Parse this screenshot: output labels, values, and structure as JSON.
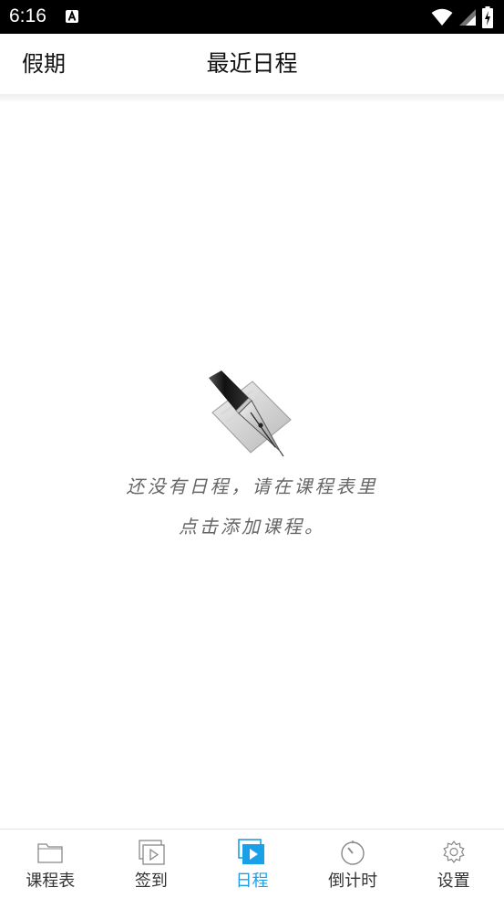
{
  "status_bar": {
    "time": "6:16",
    "icons": [
      "notification-a-icon",
      "wifi-icon",
      "signal-icon",
      "battery-charging-icon"
    ]
  },
  "header": {
    "left_label": "假期",
    "title": "最近日程"
  },
  "empty_state": {
    "icon": "fountain-pen-icon",
    "line1": "还没有日程，请在课程表里",
    "line2": "点击添加课程。"
  },
  "bottom_nav": {
    "active_index": 2,
    "active_color": "#1aa0e8",
    "items": [
      {
        "label": "课程表",
        "icon": "folder-icon"
      },
      {
        "label": "签到",
        "icon": "video-play-icon"
      },
      {
        "label": "日程",
        "icon": "schedule-play-icon"
      },
      {
        "label": "倒计时",
        "icon": "timer-icon"
      },
      {
        "label": "设置",
        "icon": "gear-icon"
      }
    ]
  }
}
